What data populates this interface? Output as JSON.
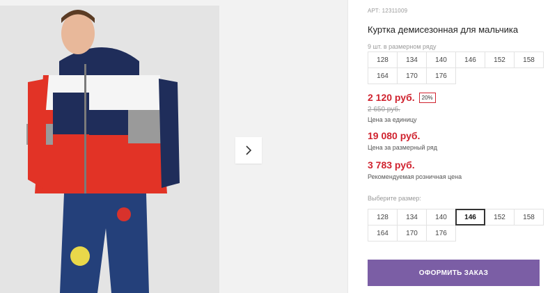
{
  "product": {
    "article": "АРТ: 12311009",
    "title": "Куртка демисезонная для мальчика",
    "pack_note": "9 шт. в размерном ряду",
    "pack_sizes": [
      "128",
      "134",
      "140",
      "146",
      "152",
      "158",
      "164",
      "170",
      "176"
    ]
  },
  "pricing": {
    "unit_price": "2 120 руб.",
    "discount": "20%",
    "old_price": "2 650 руб.",
    "unit_label": "Цена за единицу",
    "range_price": "19 080 руб.",
    "range_label": "Цена за размерный ряд",
    "retail_price": "3 783 руб.",
    "retail_label": "Рекомендуемая розничная цена"
  },
  "size_select": {
    "label": "Выберите размер:",
    "options": [
      "128",
      "134",
      "140",
      "146",
      "152",
      "158",
      "164",
      "170",
      "176"
    ],
    "selected": "146"
  },
  "actions": {
    "order_label": "ОФОРМИТЬ ЗАКАЗ"
  },
  "gallery": {
    "next_icon": "chevron-right-icon"
  },
  "colors": {
    "price_red": "#d0232f",
    "button_purple": "#7b5ea5"
  }
}
